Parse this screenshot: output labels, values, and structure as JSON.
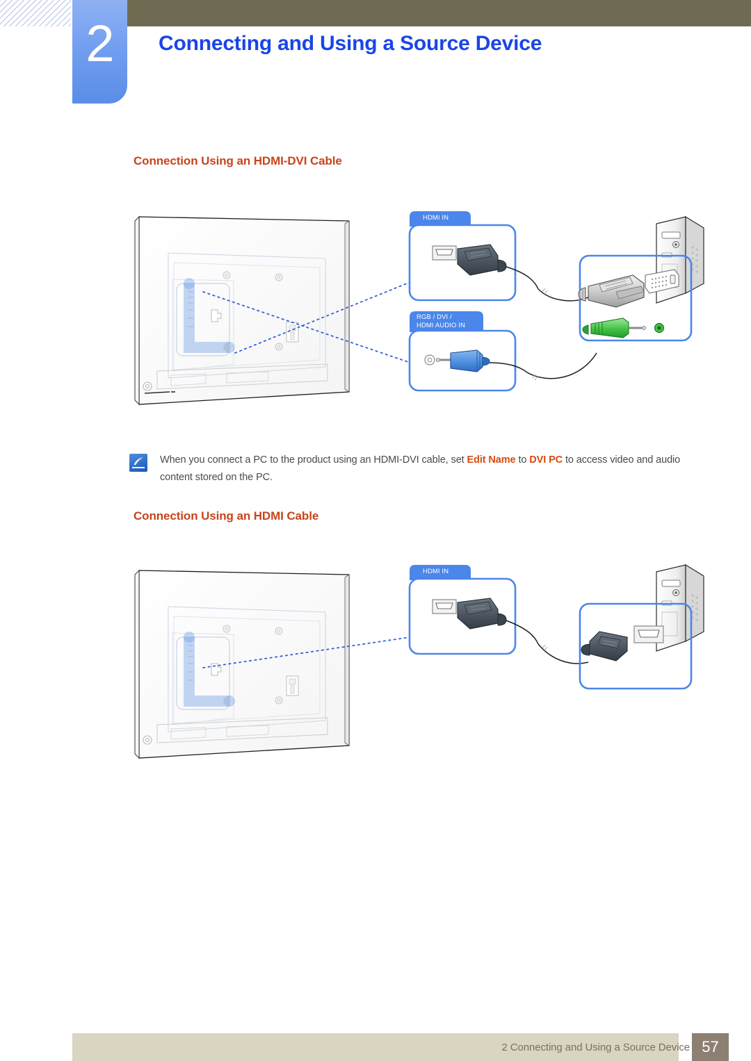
{
  "header": {
    "chapter_number": "2",
    "chapter_title": "Connecting and Using a Source Device",
    "olive_bar_color": "#6e6b52",
    "tab_color": "#719ef0",
    "title_color": "#1a45e8"
  },
  "sections": [
    {
      "id": "hdmi-dvi",
      "heading": "Connection Using an HDMI-DVI Cable",
      "heading_color": "#c7441b",
      "callouts": [
        {
          "id": "hdmi-in",
          "label_line1": "HDMI IN",
          "label_line2": ""
        },
        {
          "id": "rgb-dvi-hdmi-audio-in",
          "label_line1": "RGB / DVI /",
          "label_line2": "HDMI AUDIO IN"
        }
      ],
      "devices": [
        "display-rear-panel",
        "pc-tower"
      ],
      "cables": [
        "hdmi-to-dvi-cable",
        "stereo-audio-cable"
      ]
    },
    {
      "id": "hdmi",
      "heading": "Connection Using an HDMI Cable",
      "heading_color": "#c7441b",
      "callouts": [
        {
          "id": "hdmi-in",
          "label_line1": "HDMI IN",
          "label_line2": ""
        }
      ],
      "devices": [
        "display-rear-panel",
        "pc-tower"
      ],
      "cables": [
        "hdmi-cable"
      ]
    }
  ],
  "note": {
    "icon_name": "note-pen-icon",
    "text_before_kw1": "When you connect a PC to the product using an HDMI-DVI cable, set ",
    "keyword_1": "Edit Name",
    "text_between": " to ",
    "keyword_2": "DVI PC",
    "text_after": " to access video and audio content stored on the PC.",
    "keyword_color": "#d94a12"
  },
  "footer": {
    "text": "2 Connecting and Using a Source Device",
    "page_number": "57",
    "bar_color": "#d9d5c0",
    "page_box_color": "#8d7f72"
  }
}
